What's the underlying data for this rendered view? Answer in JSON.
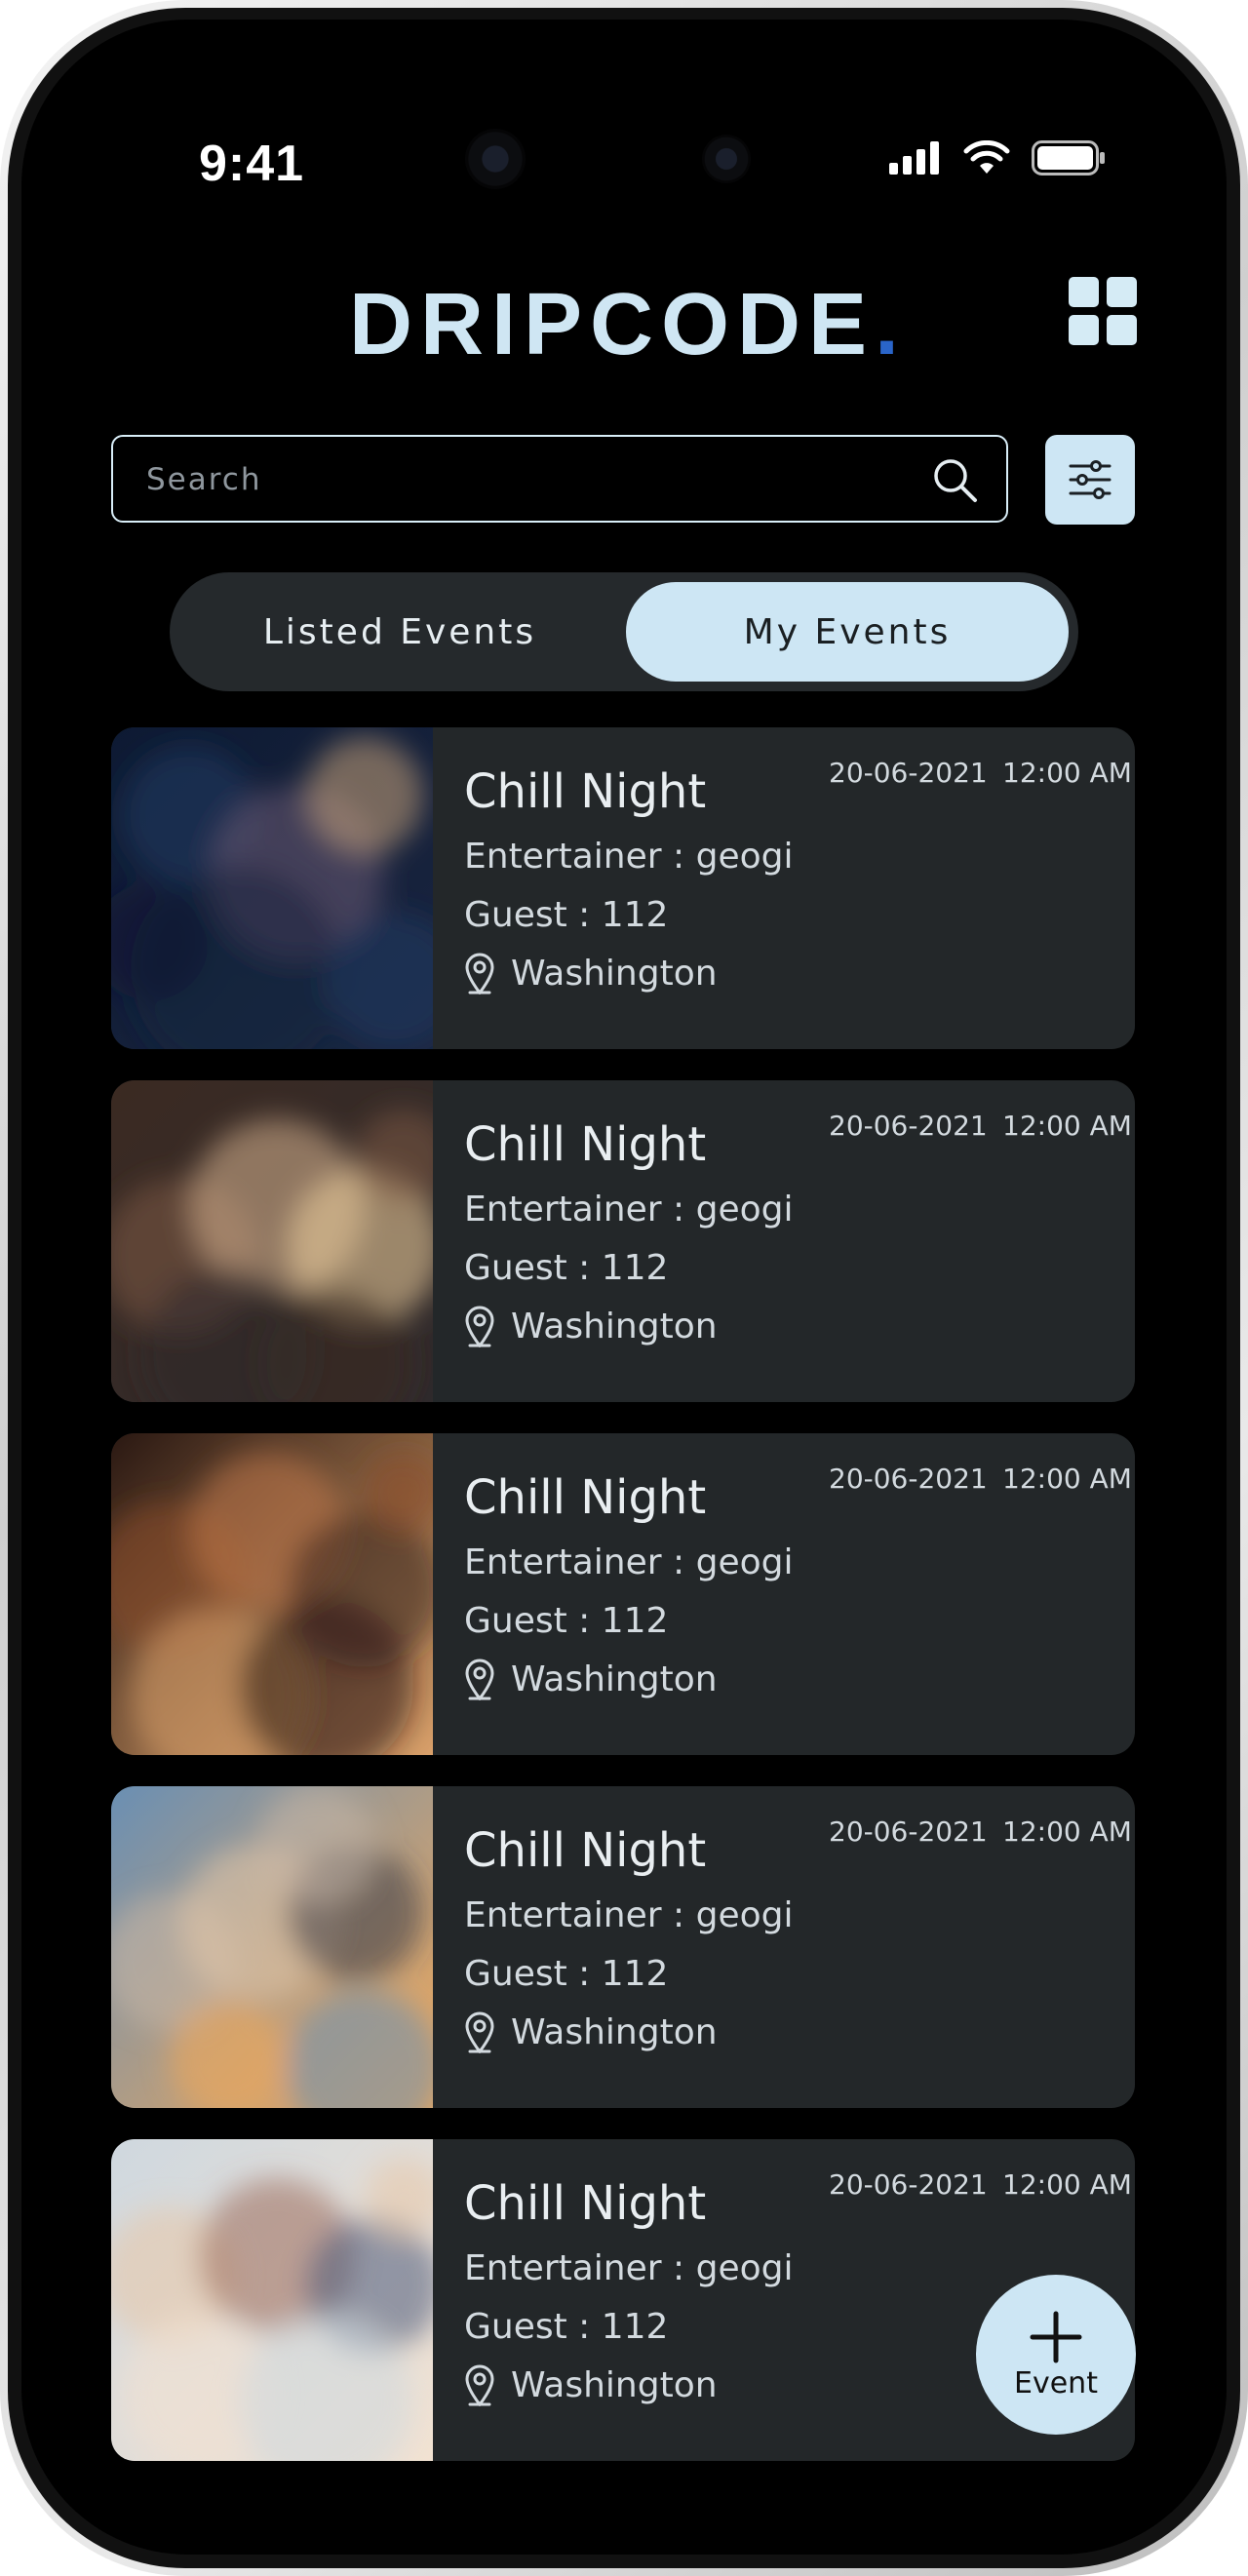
{
  "status_bar": {
    "time": "9:41"
  },
  "header": {
    "logo": "DRIPCODE",
    "logo_dot": ".",
    "accent_color": "#2a65c9",
    "menu_icon": "grid-icon"
  },
  "search": {
    "placeholder": "Search",
    "value": "",
    "icon": "search-icon",
    "filter_icon": "filter-sliders-icon"
  },
  "tabs": [
    {
      "label": "Listed Events",
      "selected": false
    },
    {
      "label": "My Events",
      "selected": true
    }
  ],
  "events": [
    {
      "title": "Chill Night",
      "entertainer": "Entertainer : geogi",
      "guests": "Guest : 112",
      "location": "Washington",
      "date": "20-06-2021",
      "time": "12:00 AM"
    },
    {
      "title": "Chill Night",
      "entertainer": "Entertainer : geogi",
      "guests": "Guest : 112",
      "location": "Washington",
      "date": "20-06-2021",
      "time": "12:00 AM"
    },
    {
      "title": "Chill Night",
      "entertainer": "Entertainer : geogi",
      "guests": "Guest : 112",
      "location": "Washington",
      "date": "20-06-2021",
      "time": "12:00 AM"
    },
    {
      "title": "Chill Night",
      "entertainer": "Entertainer : geogi",
      "guests": "Guest : 112",
      "location": "Washington",
      "date": "20-06-2021",
      "time": "12:00 AM"
    },
    {
      "title": "Chill Night",
      "entertainer": "Entertainer : geogi",
      "guests": "Guest : 112",
      "location": "Washington",
      "date": "20-06-2021",
      "time": "12:00 AM"
    }
  ],
  "fab": {
    "icon": "plus-icon",
    "label": "Event"
  }
}
